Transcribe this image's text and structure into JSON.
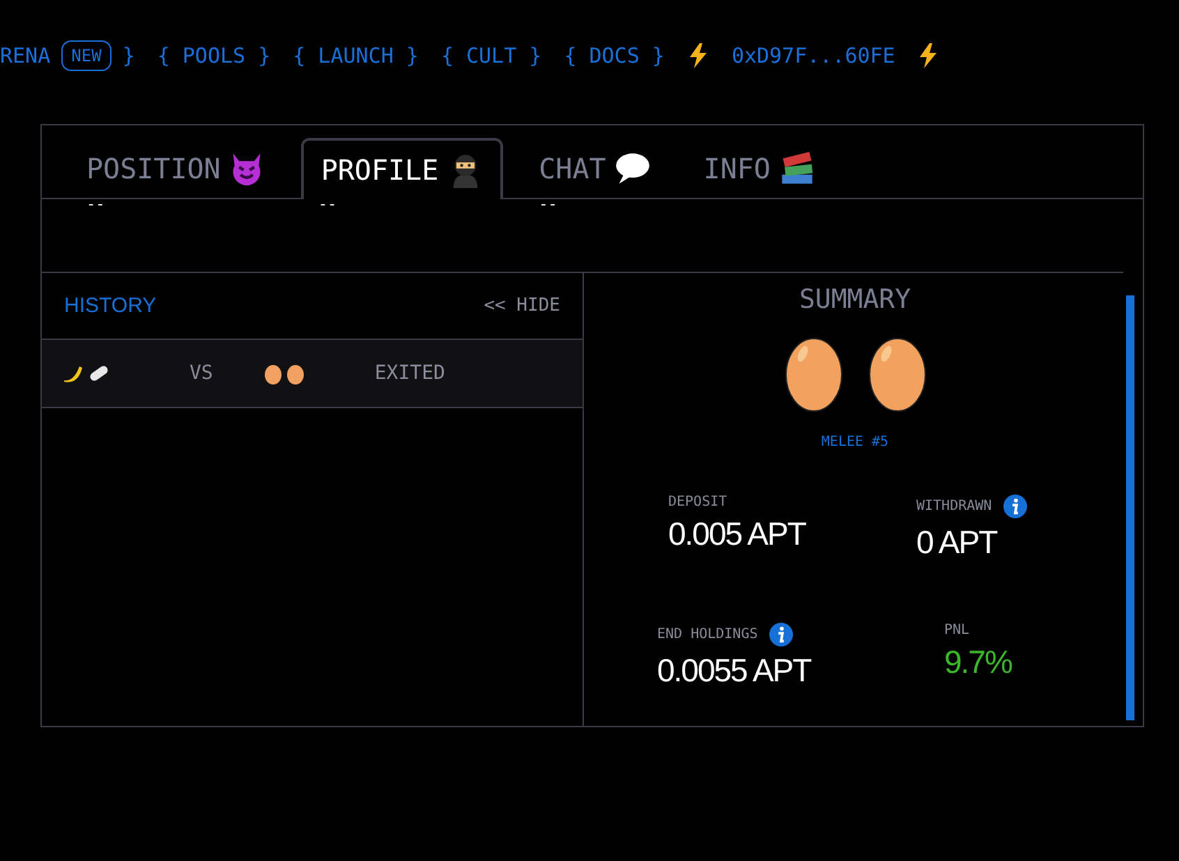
{
  "nav": {
    "items": [
      {
        "kind": "text",
        "label": "RENA"
      },
      {
        "kind": "badge",
        "label": "NEW"
      },
      {
        "kind": "text",
        "label": "}"
      },
      {
        "kind": "text",
        "label": "{ POOLS }"
      },
      {
        "kind": "text",
        "label": "{ LAUNCH }"
      },
      {
        "kind": "text",
        "label": "{ CULT }"
      },
      {
        "kind": "text",
        "label": "{ DOCS }"
      },
      {
        "kind": "bolt"
      },
      {
        "kind": "text",
        "label": "0xD97F...60FE"
      },
      {
        "kind": "bolt"
      }
    ]
  },
  "tabs": [
    {
      "label": "POSITION",
      "selected": false,
      "sub": "--"
    },
    {
      "label": "PROFILE",
      "selected": true,
      "sub": "--"
    },
    {
      "label": "CHAT",
      "selected": false,
      "sub": "--"
    },
    {
      "label": "INFO",
      "selected": false
    }
  ],
  "history": {
    "title": "HISTORY",
    "hide": "<< HIDE",
    "rows": [
      {
        "vs": "VS",
        "status": "EXITED"
      }
    ]
  },
  "summary": {
    "title": "SUMMARY",
    "melee": "MELEE #5",
    "stats": [
      {
        "label": "DEPOSIT",
        "value": "0.005 APT",
        "info": false,
        "positive": false
      },
      {
        "label": "WITHDRAWN",
        "value": "0 APT",
        "info": true,
        "positive": false
      },
      {
        "label": "END HOLDINGS",
        "value": "0.0055 APT",
        "info": true,
        "positive": false
      },
      {
        "label": "PNL",
        "value": "9.7%",
        "info": false,
        "positive": true
      }
    ]
  }
}
